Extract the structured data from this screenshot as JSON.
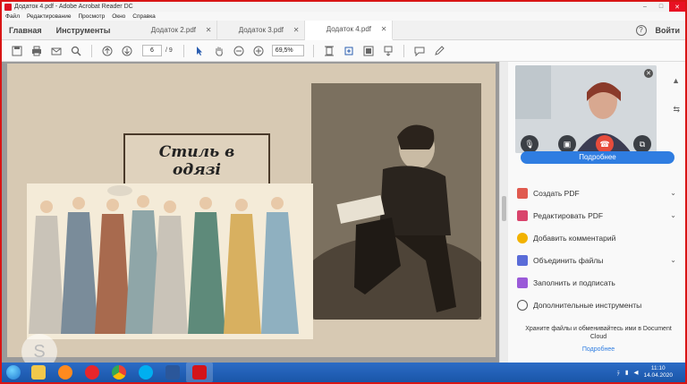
{
  "window": {
    "title": "Додаток 4.pdf - Adobe Acrobat Reader DC"
  },
  "menu": [
    "Файл",
    "Редактирование",
    "Просмотр",
    "Окно",
    "Справка"
  ],
  "tabs": {
    "home": "Главная",
    "tools": "Инструменты",
    "docs": [
      {
        "label": "Додаток 2.pdf"
      },
      {
        "label": "Додаток 3.pdf"
      },
      {
        "label": "Додаток 4.pdf"
      }
    ],
    "help": "?",
    "signin": "Войти"
  },
  "toolbar": {
    "page_current": "6",
    "page_total": "/ 9",
    "zoom": "69,5%"
  },
  "slide": {
    "title": "Стиль в одязі"
  },
  "panel": {
    "more_button": "Подробнее",
    "tools": [
      {
        "label": "Создать PDF",
        "color": "#e05a4f",
        "chevron": true
      },
      {
        "label": "Редактировать PDF",
        "color": "#d9446c",
        "chevron": true
      },
      {
        "label": "Добавить комментарий",
        "color": "#f2b200",
        "chevron": false
      },
      {
        "label": "Объединить файлы",
        "color": "#5a6cd8",
        "chevron": true
      },
      {
        "label": "Заполнить и подписать",
        "color": "#9a5ad8",
        "chevron": false
      },
      {
        "label": "Дополнительные инструменты",
        "color": "#555555",
        "chevron": false
      }
    ],
    "cloud_text": "Храните файлы и обменивайтесь ими в Document Cloud",
    "cloud_link": "Подробнее"
  },
  "taskbar": {
    "lang": "ﾃ",
    "time": "11:10",
    "date": "14.04.2020",
    "apps": [
      {
        "name": "explorer",
        "color": "#f2c84b"
      },
      {
        "name": "firefox",
        "color": "#ff8a1f"
      },
      {
        "name": "opera",
        "color": "#e8262b"
      },
      {
        "name": "chrome",
        "color": "#4caf50"
      },
      {
        "name": "skype",
        "color": "#00aff0"
      },
      {
        "name": "word",
        "color": "#2b579a"
      },
      {
        "name": "acrobat",
        "color": "#d4141a"
      }
    ]
  }
}
